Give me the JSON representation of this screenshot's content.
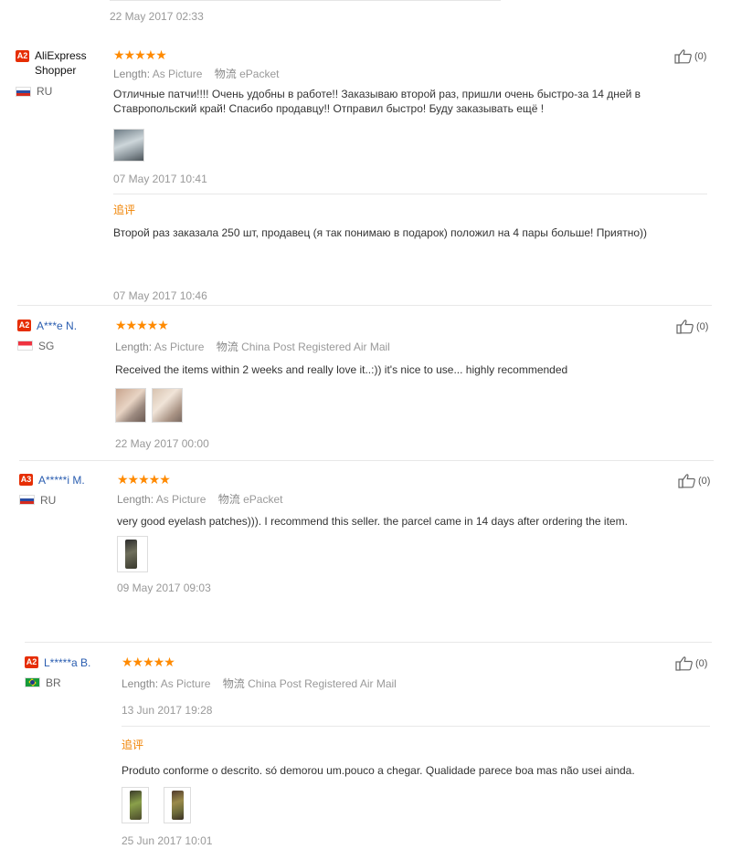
{
  "prev_review": {
    "date": "22 May 2017 02:33"
  },
  "reviews": [
    {
      "badge": "A2",
      "name": "AliExpress Shopper",
      "country": "RU",
      "stars": "★★★★★",
      "length_label": "Length:",
      "length_value": "As Picture",
      "logistics_label": "物流",
      "logistics_value": "ePacket",
      "text": "Отличные патчи!!!! Очень удобны в работе!! Заказываю второй раз, пришли очень быстро-за 14 дней в Ставропольский край! Спасибо продавцу!! Отправил быстро! Буду заказывать ещё !",
      "date": "07 May 2017 10:41",
      "additional_label": "追评",
      "additional_text": "Второй раз заказала 250 шт, продавец (я так понимаю в подарок) положил на 4 пары больше! Приятно))",
      "additional_date": "07 May 2017 10:46",
      "likes": "(0)"
    },
    {
      "badge": "A2",
      "name": "A***e N.",
      "country": "SG",
      "stars": "★★★★★",
      "length_label": "Length:",
      "length_value": "As Picture",
      "logistics_label": "物流",
      "logistics_value": "China Post Registered Air Mail",
      "text": "Received the items within 2 weeks and really love it..:)) it's nice to use... highly recommended",
      "date": "22 May 2017 00:00",
      "likes": "(0)"
    },
    {
      "badge": "A3",
      "name": "A*****i M.",
      "country": "RU",
      "stars": "★★★★★",
      "length_label": "Length:",
      "length_value": "As Picture",
      "logistics_label": "物流",
      "logistics_value": "ePacket",
      "text": "very good eyelash patches))). I recommend this seller. the parcel came in 14 days after ordering the item.",
      "date": "09 May 2017 09:03",
      "likes": "(0)"
    },
    {
      "badge": "A2",
      "name": "L*****a B.",
      "country": "BR",
      "stars": "★★★★★",
      "length_label": "Length:",
      "length_value": "As Picture",
      "logistics_label": "物流",
      "logistics_value": "China Post Registered Air Mail",
      "date": "13 Jun 2017 19:28",
      "additional_label": "追评",
      "additional_text": "Produto conforme o descrito. só demorou um.pouco a chegar. Qualidade parece boa mas não usei ainda.",
      "additional_date": "25 Jun 2017 10:01",
      "likes": "(0)"
    }
  ],
  "colors": {
    "stars": "#ff8a00",
    "badge": "#e62e04",
    "additional": "#f08200",
    "username_blue": "#2a5db0"
  },
  "icons": {
    "like": "thumbs-up-icon"
  }
}
